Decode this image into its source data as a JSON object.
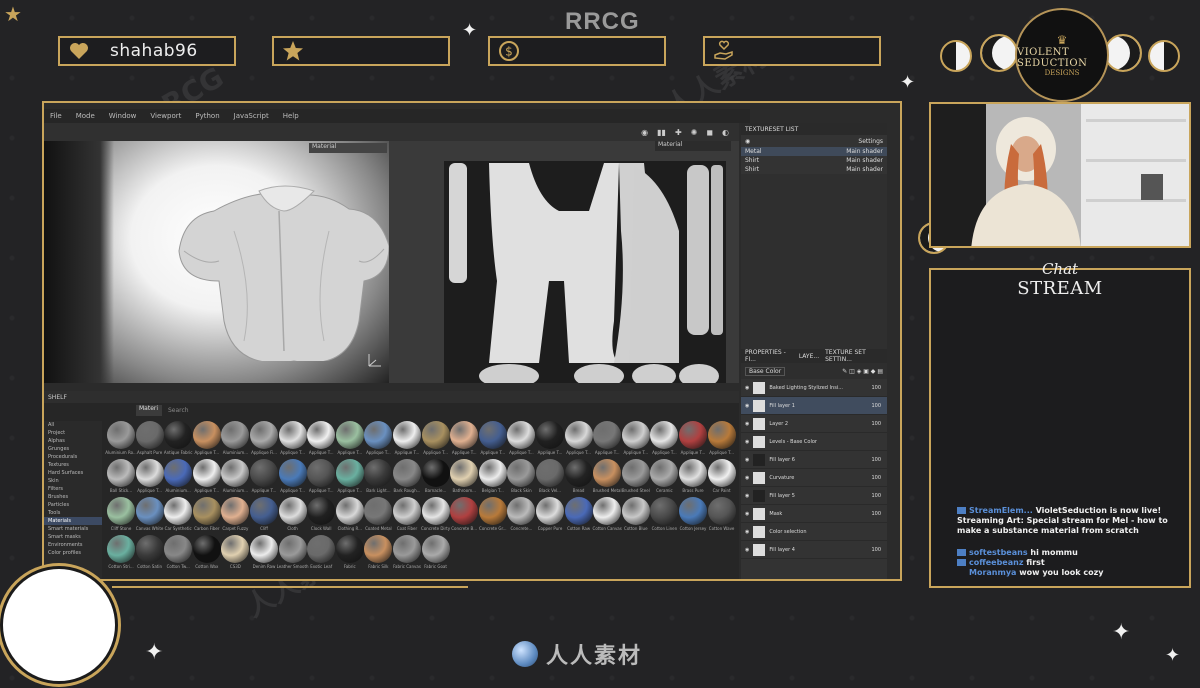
{
  "overlay": {
    "watermark_top": "RRCG",
    "watermark_center": "人人素材",
    "stats": [
      {
        "icon": "heart-icon",
        "value": "shahab96"
      },
      {
        "icon": "star-icon",
        "value": ""
      },
      {
        "icon": "dollar-coin-icon",
        "value": ""
      },
      {
        "icon": "hand-heart-icon",
        "value": ""
      }
    ],
    "logo": {
      "title": "VIOLENT SEDUCTION",
      "subtitle": "DESIGNS"
    },
    "chat_title_script": "Chat",
    "chat_title": "STREAM",
    "footer_brand": "人人素材",
    "accent_color": "#c9a55b"
  },
  "app": {
    "menu": [
      "File",
      "Mode",
      "Window",
      "Viewport",
      "Python",
      "JavaScript",
      "Help"
    ],
    "viewport_3d_label": "Material",
    "viewport_2d_label": "Material",
    "texture_set_list": {
      "title": "TEXTURESET LIST",
      "settings_label": "Settings",
      "items": [
        {
          "name": "Metal",
          "shader": "Main shader",
          "selected": true
        },
        {
          "name": "Shirt",
          "shader": "Main shader",
          "selected": false
        },
        {
          "name": "Shirt",
          "shader": "Main shader",
          "selected": false
        }
      ]
    },
    "panel_tabs": [
      "PROPERTIES - FI...",
      "LAYE...",
      "TEXTURE SET SETTIN..."
    ],
    "base_color_select": "Base Color",
    "layers": [
      {
        "name": "Baked Lighting Stylized Insi...",
        "opacity": "100",
        "dark": false,
        "selected": false
      },
      {
        "name": "Fill layer 1",
        "opacity": "100",
        "dark": false,
        "selected": true
      },
      {
        "name": "Layer 2",
        "opacity": "100",
        "dark": false,
        "selected": false
      },
      {
        "name": "Levels - Base Color",
        "opacity": "",
        "dark": false,
        "selected": false
      },
      {
        "name": "Fill layer 6",
        "opacity": "100",
        "dark": true,
        "selected": false
      },
      {
        "name": "Curvature",
        "opacity": "100",
        "dark": false,
        "selected": false
      },
      {
        "name": "Fill layer 5",
        "opacity": "100",
        "dark": true,
        "selected": false
      },
      {
        "name": "Mask",
        "opacity": "100",
        "dark": false,
        "selected": false
      },
      {
        "name": "Color selection",
        "opacity": "",
        "dark": false,
        "selected": false
      },
      {
        "name": "Fill layer 4",
        "opacity": "100",
        "dark": false,
        "selected": false
      }
    ],
    "shelf": {
      "title": "SHELF",
      "search_tab": "Materi",
      "search_placeholder": "Search",
      "categories": [
        "All",
        "Project",
        "Alphas",
        "Grunges",
        "Procedurals",
        "Textures",
        "Hard Surfaces",
        "Skin",
        "Filters",
        "Brushes",
        "Particles",
        "Tools",
        "Materials",
        "Smart materials",
        "Smart masks",
        "Environments",
        "Color profiles"
      ],
      "selected_category": "Materials",
      "materials": [
        "Aluminium Ro...",
        "Asphalt Pure",
        "Antique Fabric",
        "Applique T...",
        "Aluminium...",
        "Applique Fi...",
        "Applique T...",
        "Applique T...",
        "Applique T...",
        "Applique T...",
        "Applique T...",
        "Applique T...",
        "Applique T...",
        "Applique T...",
        "Applique T...",
        "Applique T...",
        "Applique T...",
        "Applique T...",
        "Applique T...",
        "Applique T...",
        "Applique T...",
        "Applique T...",
        "Ball Stick...",
        "Applique T...",
        "Aluminium...",
        "Applique T...",
        "Aluminium...",
        "Applique T...",
        "Applique T...",
        "Applique T...",
        "Applique T...",
        "Bark Light...",
        "Bark Rough...",
        "Barnacle...",
        "Bathroom...",
        "Belgian T...",
        "Black Skin",
        "Black Vel...",
        "Bread",
        "Brushed Metal",
        "Brushed Steel",
        "Ceramic",
        "Brass Pure",
        "Car Paint",
        "Cliff Stone",
        "Canvas White",
        "Car Synthetic",
        "Carbon Fiber",
        "Carpet Fuzzy",
        "Cliff",
        "Cloth",
        "Clock Wall",
        "Clothing R...",
        "Coated Metal",
        "Coat Fiber",
        "Concrete Dirty",
        "Concrete B...",
        "Concrete Gr...",
        "Concrete...",
        "Copper Pure",
        "Cotton Raw",
        "Cotton Canvas",
        "Cotton Blue",
        "Cotton Linen",
        "Cotton Jersey",
        "Cotton Wave",
        "Cotton Stri...",
        "Cotton Satin",
        "Cotton Tw...",
        "Cotton Wax",
        "CS3D",
        "Denim Raw",
        "Leather Smooth",
        "Exotic Leaf",
        "Fabric",
        "Fabric Silk",
        "Fabric Canvas",
        "Fabric Goat"
      ]
    }
  },
  "chat": {
    "messages": [
      {
        "user": "StreamElem...",
        "text": "VioletSeduction is now live! Streaming Art: Special stream for Mel - how to make a substance material from scratch"
      },
      {
        "user": "softestbeans",
        "text": "hi mommu"
      },
      {
        "user": "coffeebeanz",
        "text": "first"
      },
      {
        "user": "Moranmya",
        "text": "wow you look cozy"
      }
    ]
  }
}
